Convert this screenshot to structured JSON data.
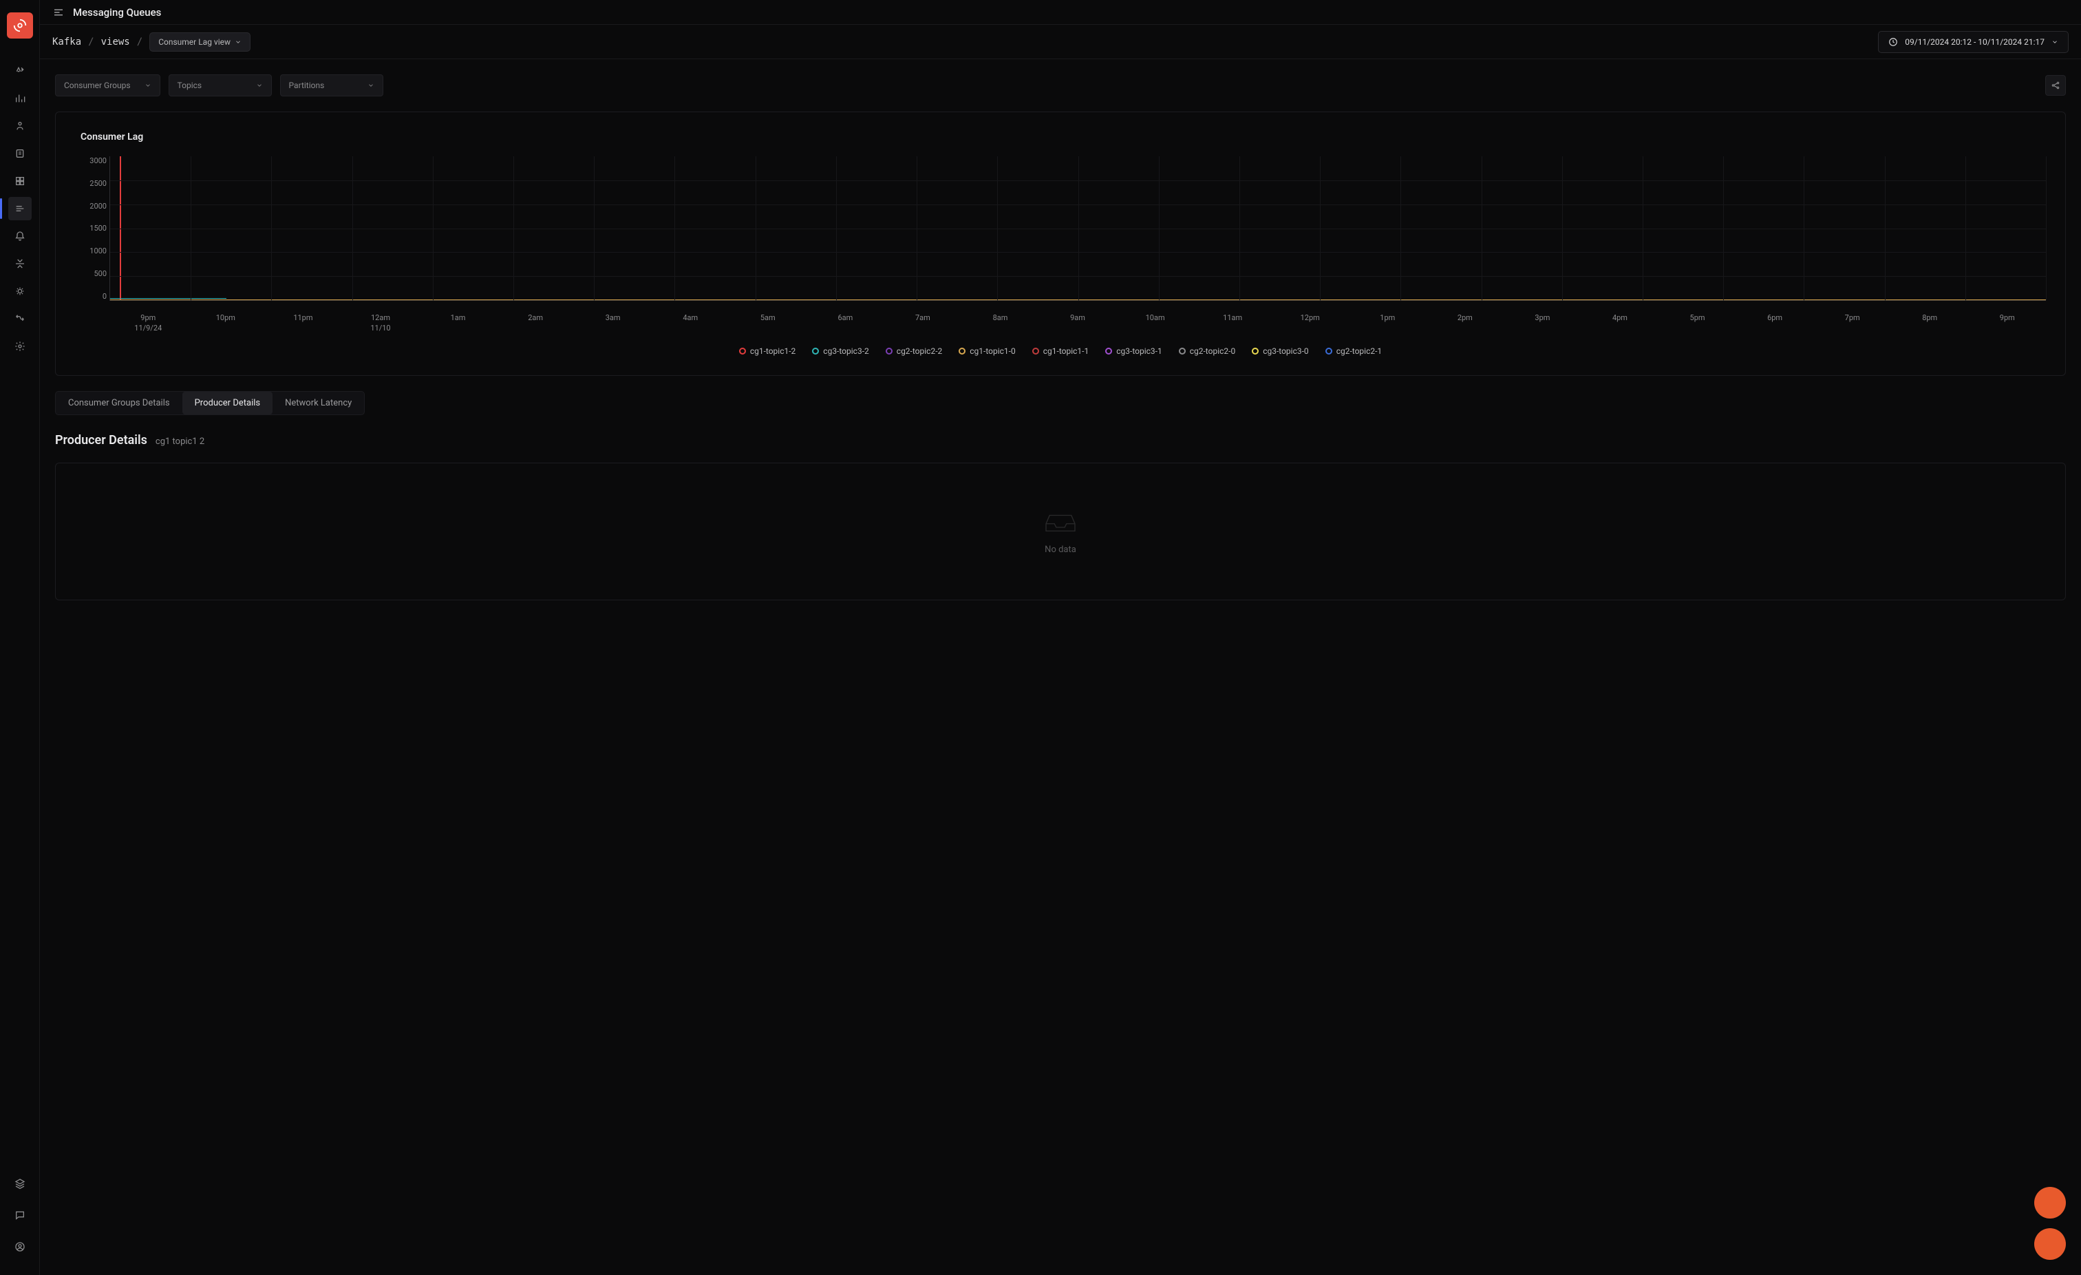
{
  "header": {
    "title": "Messaging Queues"
  },
  "breadcrumb": {
    "part1": "Kafka",
    "part2": "views",
    "view_selector": "Consumer Lag view"
  },
  "time_range": "09/11/2024 20:12 - 10/11/2024 21:17",
  "filters": {
    "groups": "Consumer Groups",
    "topics": "Topics",
    "partitions": "Partitions"
  },
  "chart": {
    "title": "Consumer Lag"
  },
  "chart_data": {
    "type": "line",
    "title": "Consumer Lag",
    "xlabel": "",
    "ylabel": "",
    "ylim": [
      0,
      3000
    ],
    "y_ticks": [
      "3000",
      "2500",
      "2000",
      "1500",
      "1000",
      "500",
      "0"
    ],
    "x_ticks": [
      "9pm",
      "10pm",
      "11pm",
      "12am",
      "1am",
      "2am",
      "3am",
      "4am",
      "5am",
      "6am",
      "7am",
      "8am",
      "9am",
      "10am",
      "11am",
      "12pm",
      "1pm",
      "2pm",
      "3pm",
      "4pm",
      "5pm",
      "6pm",
      "7pm",
      "8pm",
      "9pm"
    ],
    "x_date_labels": {
      "0": "11/9/24",
      "3": "11/10"
    },
    "series": [
      {
        "name": "cg1-topic1-2",
        "color": "#e23c3c",
        "values": [
          3000,
          0,
          0,
          0,
          0,
          0,
          0,
          0,
          0,
          0,
          0,
          0,
          0,
          0,
          0,
          0,
          0,
          0,
          0,
          0,
          0,
          0,
          0,
          0,
          0
        ]
      },
      {
        "name": "cg3-topic3-2",
        "color": "#2fb5b5",
        "values": [
          50,
          30,
          0,
          0,
          0,
          0,
          0,
          0,
          0,
          0,
          0,
          0,
          0,
          0,
          0,
          0,
          0,
          0,
          0,
          0,
          0,
          0,
          0,
          0,
          0
        ]
      },
      {
        "name": "cg2-topic2-2",
        "color": "#7b3fb5",
        "values": [
          0,
          0,
          0,
          0,
          0,
          0,
          0,
          0,
          0,
          0,
          0,
          0,
          0,
          0,
          0,
          0,
          0,
          0,
          0,
          0,
          0,
          0,
          0,
          0,
          0
        ]
      },
      {
        "name": "cg1-topic1-0",
        "color": "#d8a850",
        "values": [
          0,
          0,
          0,
          0,
          0,
          0,
          0,
          0,
          0,
          0,
          0,
          0,
          0,
          0,
          0,
          0,
          0,
          0,
          0,
          0,
          0,
          0,
          0,
          0,
          0
        ]
      },
      {
        "name": "cg1-topic1-1",
        "color": "#c03c3c",
        "values": [
          0,
          0,
          0,
          0,
          0,
          0,
          0,
          0,
          0,
          0,
          0,
          0,
          0,
          0,
          0,
          0,
          0,
          0,
          0,
          0,
          0,
          0,
          0,
          0,
          0
        ]
      },
      {
        "name": "cg3-topic3-1",
        "color": "#a050d0",
        "values": [
          0,
          0,
          0,
          0,
          0,
          0,
          0,
          0,
          0,
          0,
          0,
          0,
          0,
          0,
          0,
          0,
          0,
          0,
          0,
          0,
          0,
          0,
          0,
          0,
          0
        ]
      },
      {
        "name": "cg2-topic2-0",
        "color": "#8a8a8c",
        "values": [
          0,
          0,
          0,
          0,
          0,
          0,
          0,
          0,
          0,
          0,
          0,
          0,
          0,
          0,
          0,
          0,
          0,
          0,
          0,
          0,
          0,
          0,
          0,
          0,
          0
        ]
      },
      {
        "name": "cg3-topic3-0",
        "color": "#e8d850",
        "values": [
          0,
          0,
          0,
          0,
          0,
          0,
          0,
          0,
          0,
          0,
          0,
          0,
          0,
          0,
          0,
          0,
          0,
          0,
          0,
          0,
          0,
          0,
          0,
          0,
          0
        ]
      },
      {
        "name": "cg2-topic2-1",
        "color": "#3a6cd8",
        "values": [
          0,
          0,
          0,
          0,
          0,
          0,
          0,
          0,
          0,
          0,
          0,
          0,
          0,
          0,
          0,
          0,
          0,
          0,
          0,
          0,
          0,
          0,
          0,
          0,
          0
        ]
      }
    ]
  },
  "tabs": {
    "t0": "Consumer Groups Details",
    "t1": "Producer Details",
    "t2": "Network Latency"
  },
  "detail": {
    "title": "Producer Details",
    "sub": "cg1 topic1 2",
    "empty": "No data"
  }
}
